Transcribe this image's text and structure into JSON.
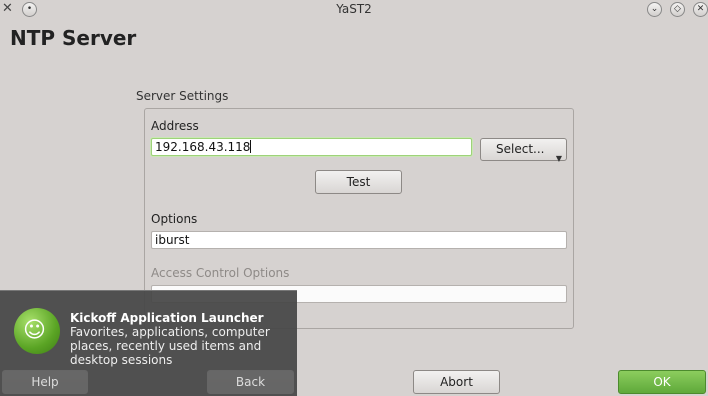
{
  "window": {
    "title": "YaST2",
    "close_left_icon": "x-icon",
    "buttons": [
      "minimize-icon",
      "maximize-icon",
      "close-icon"
    ]
  },
  "page": {
    "title": "NTP Server"
  },
  "server_settings": {
    "group_label": "Server Settings",
    "address_label": "Address",
    "address_value": "192.168.43.118",
    "select_button": "Select...",
    "test_button": "Test",
    "options_label": "Options",
    "options_value": "iburst",
    "access_control_label": "Access Control Options",
    "access_control_value": ""
  },
  "tooltip": {
    "title": "Kickoff Application Launcher",
    "description": "Favorites, applications, computer places, recently used items and desktop sessions"
  },
  "footer": {
    "help": "Help",
    "back": "Back",
    "abort": "Abort",
    "ok": "OK"
  },
  "colors": {
    "background": "#d6d2d0",
    "ok_button": "#6fb845",
    "focus_border": "#9ed27a"
  }
}
